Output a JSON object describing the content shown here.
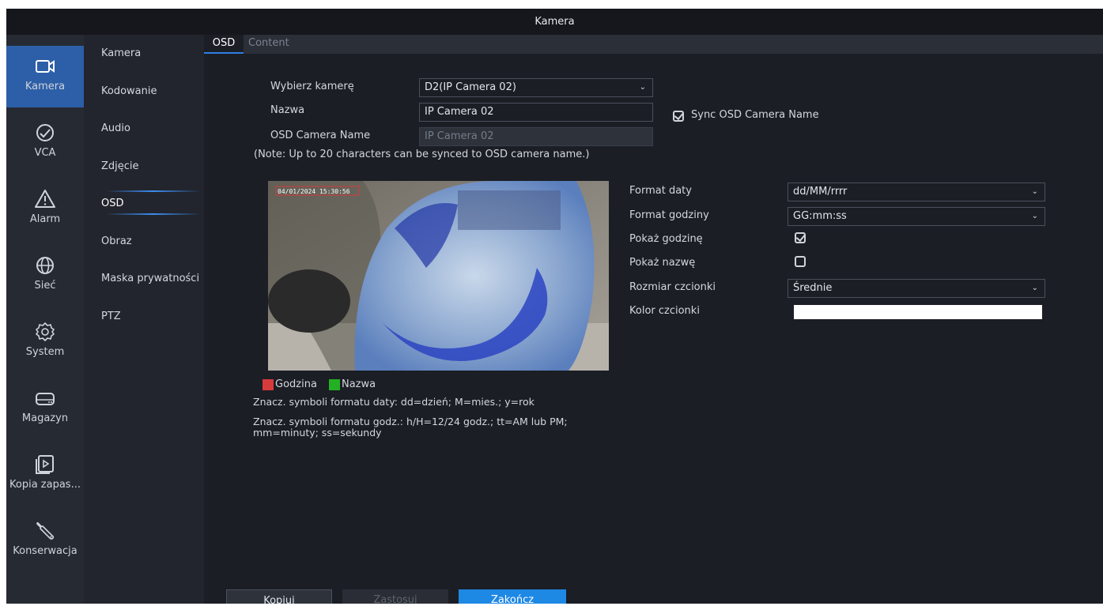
{
  "window": {
    "title": "Kamera"
  },
  "left_nav": [
    {
      "label": "Kamera",
      "icon": "camera-icon",
      "active": true
    },
    {
      "label": "VCA",
      "icon": "vca-icon",
      "active": false
    },
    {
      "label": "Alarm",
      "icon": "alarm-icon",
      "active": false
    },
    {
      "label": "Sieć",
      "icon": "network-globe-icon",
      "active": false
    },
    {
      "label": "System",
      "icon": "gear-icon",
      "active": false
    },
    {
      "label": "Magazyn",
      "icon": "storage-drive-icon",
      "active": false
    },
    {
      "label": "Kopia zapas...",
      "icon": "backup-icon",
      "active": false
    },
    {
      "label": "Konserwacja",
      "icon": "wrench-icon",
      "active": false
    }
  ],
  "sub_nav": [
    {
      "label": "Kamera"
    },
    {
      "label": "Kodowanie"
    },
    {
      "label": "Audio"
    },
    {
      "label": "Zdjęcie"
    },
    {
      "label": "OSD",
      "active": true
    },
    {
      "label": "Obraz"
    },
    {
      "label": "Maska prywatności"
    },
    {
      "label": "PTZ"
    }
  ],
  "tabs": [
    {
      "label": "OSD",
      "active": true
    },
    {
      "label": "Content",
      "active": false
    }
  ],
  "form": {
    "camera_label": "Wybierz kamerę",
    "camera_value": "D2(IP Camera 02)",
    "name_label": "Nazwa",
    "name_value": "IP Camera 02",
    "sync_label": "Sync OSD Camera Name",
    "sync_checked": true,
    "osd_name_label": "OSD Camera Name",
    "osd_name_value": "IP Camera 02",
    "note": "(Note: Up to 20 characters can be synced to OSD camera name.)"
  },
  "preview": {
    "timestamp": "04/01/2024 15:30:56"
  },
  "legend": {
    "time_label": "Godzina",
    "time_color": "#d63b3b",
    "name_label": "Nazwa",
    "name_color": "#23b023"
  },
  "help": {
    "date_format": "Znacz. symboli formatu daty: dd=dzień; M=mies.; y=rok",
    "time_format_1": "Znacz. symboli formatu godz.: h/H=12/24 godz.; tt=AM lub PM;",
    "time_format_2": "mm=minuty; ss=sekundy"
  },
  "settings": {
    "date_format_label": "Format daty",
    "date_format_value": "dd/MM/rrrr",
    "time_format_label": "Format godziny",
    "time_format_value": "GG:mm:ss",
    "show_time_label": "Pokaż godzinę",
    "show_time_checked": true,
    "show_name_label": "Pokaż nazwę",
    "show_name_checked": false,
    "font_size_label": "Rozmiar czcionki",
    "font_size_value": "Średnie",
    "font_color_label": "Kolor czcionki",
    "font_color_value": "#ffffff"
  },
  "buttons": {
    "copy": "Kopiuj",
    "apply": "Zastosuj",
    "finish": "Zakończ"
  },
  "colors": {
    "accent": "#2f7fe6",
    "primary_button": "#1e88e5"
  }
}
